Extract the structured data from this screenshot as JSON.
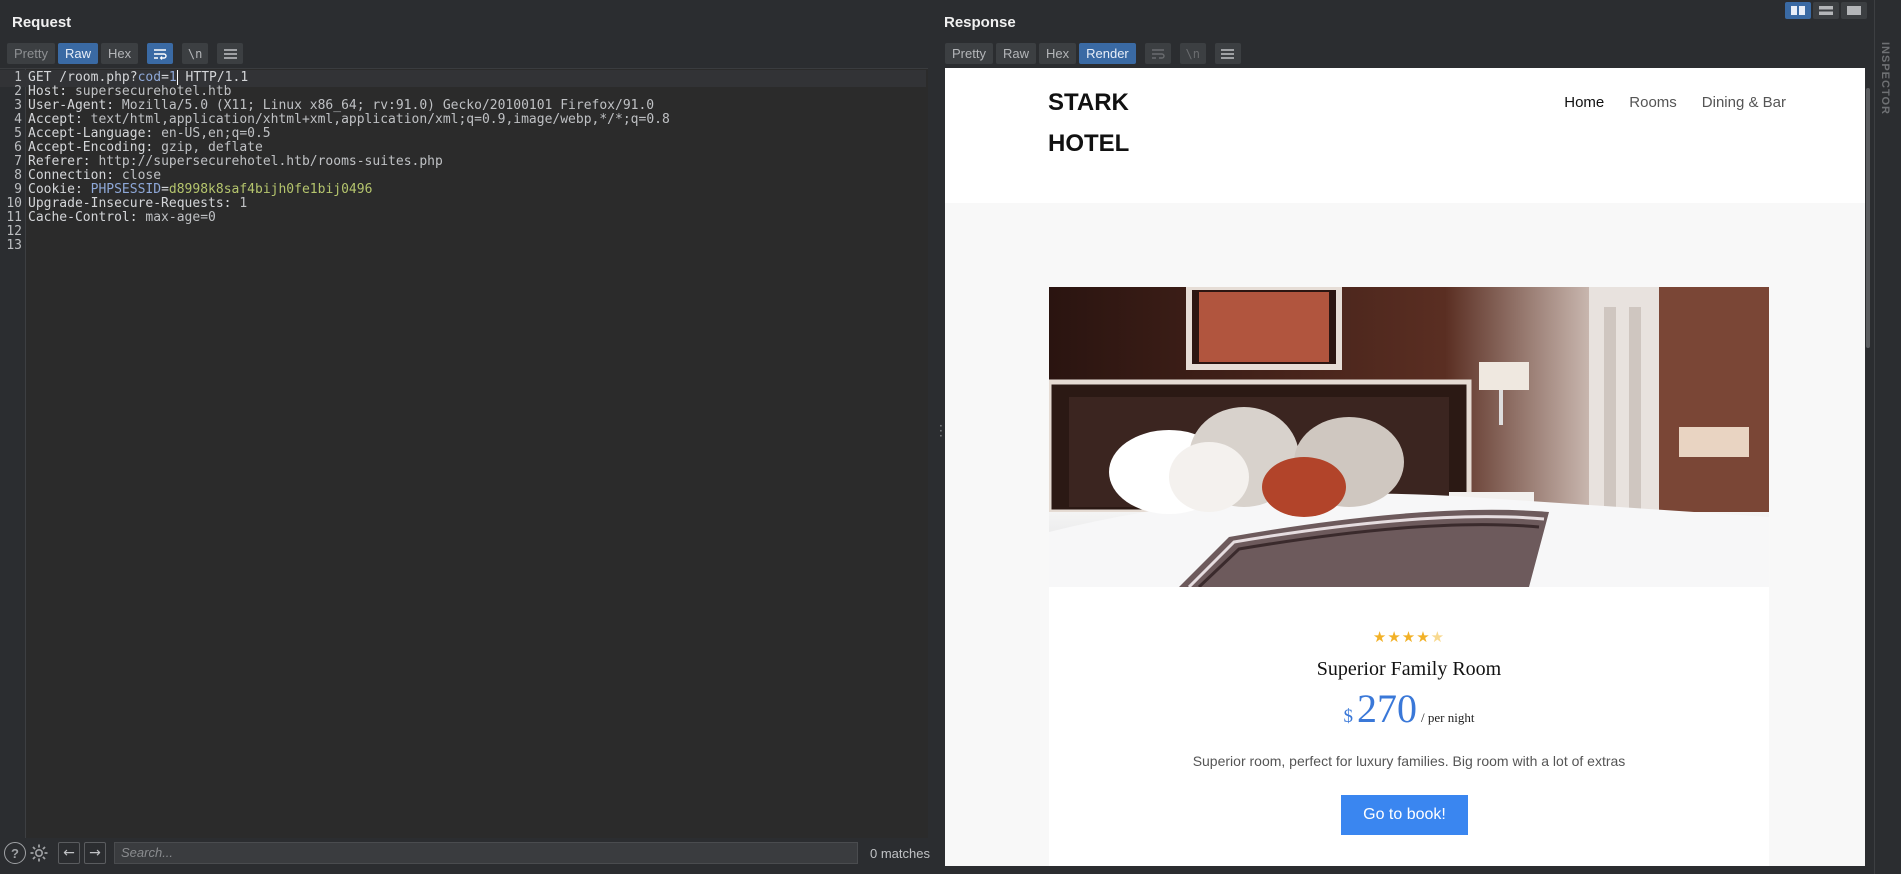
{
  "request": {
    "title": "Request",
    "tabs": [
      "Pretty",
      "Raw",
      "Hex"
    ],
    "active_tab": "Raw",
    "wrap_icon": "wrap-lines-icon",
    "newline_label": "\\n",
    "menu_icon": "hamburger-menu-icon",
    "lines": [
      {
        "n": "1",
        "parts": [
          [
            "k",
            "GET /room.php?"
          ],
          [
            "blue",
            "cod"
          ],
          [
            "k",
            "="
          ],
          [
            "blue",
            "1"
          ],
          [
            "caret",
            ""
          ],
          [
            "k",
            " HTTP/1.1"
          ]
        ]
      },
      {
        "n": "2",
        "parts": [
          [
            "k",
            "Host: "
          ],
          [
            "v",
            "supersecurehotel.htb"
          ]
        ]
      },
      {
        "n": "3",
        "parts": [
          [
            "k",
            "User-Agent: "
          ],
          [
            "v",
            "Mozilla/5.0 (X11; Linux x86_64; rv:91.0) Gecko/20100101 Firefox/91.0"
          ]
        ]
      },
      {
        "n": "4",
        "parts": [
          [
            "k",
            "Accept: "
          ],
          [
            "v",
            "text/html,application/xhtml+xml,application/xml;q=0.9,image/webp,*/*;q=0.8"
          ]
        ]
      },
      {
        "n": "5",
        "parts": [
          [
            "k",
            "Accept-Language: "
          ],
          [
            "v",
            "en-US,en;q=0.5"
          ]
        ]
      },
      {
        "n": "6",
        "parts": [
          [
            "k",
            "Accept-Encoding: "
          ],
          [
            "v",
            "gzip, deflate"
          ]
        ]
      },
      {
        "n": "7",
        "parts": [
          [
            "k",
            "Referer: "
          ],
          [
            "v",
            "http://supersecurehotel.htb/rooms-suites.php"
          ]
        ]
      },
      {
        "n": "8",
        "parts": [
          [
            "k",
            "Connection: "
          ],
          [
            "v",
            "close"
          ]
        ]
      },
      {
        "n": "9",
        "parts": [
          [
            "k",
            "Cookie: "
          ],
          [
            "blue",
            "PHPSESSID"
          ],
          [
            "k",
            "="
          ],
          [
            "green",
            "d8998k8saf4bijh0fe1bij0496"
          ]
        ]
      },
      {
        "n": "10",
        "parts": [
          [
            "k",
            "Upgrade-Insecure-Requests: "
          ],
          [
            "v",
            "1"
          ]
        ]
      },
      {
        "n": "11",
        "parts": [
          [
            "k",
            "Cache-Control: "
          ],
          [
            "v",
            "max-age=0"
          ]
        ]
      },
      {
        "n": "12",
        "parts": []
      },
      {
        "n": "13",
        "parts": []
      }
    ],
    "search_placeholder": "Search...",
    "matches": "0 matches"
  },
  "response": {
    "title": "Response",
    "tabs": [
      "Pretty",
      "Raw",
      "Hex",
      "Render"
    ],
    "active_tab": "Render",
    "newline_label": "\\n",
    "site": {
      "brand_line1": "STARK",
      "brand_line2": "HOTEL",
      "nav": [
        "Home",
        "Rooms",
        "Dining & Bar"
      ],
      "stars_filled": "★★★★",
      "stars_empty": "★",
      "rating": 4,
      "rating_max": 5,
      "room_title": "Superior Family Room",
      "currency": "$",
      "price": "270",
      "per_night": "/ per night",
      "description": "Superior room, perfect for luxury families. Big room with a lot of extras",
      "cta": "Go to book!"
    }
  },
  "sidebar": {
    "inspector": "INSPECTOR"
  },
  "colors": {
    "accent": "#3a6aa4",
    "book_button": "#3a86f0",
    "price": "#3a78d8",
    "star": "#f2b127"
  }
}
